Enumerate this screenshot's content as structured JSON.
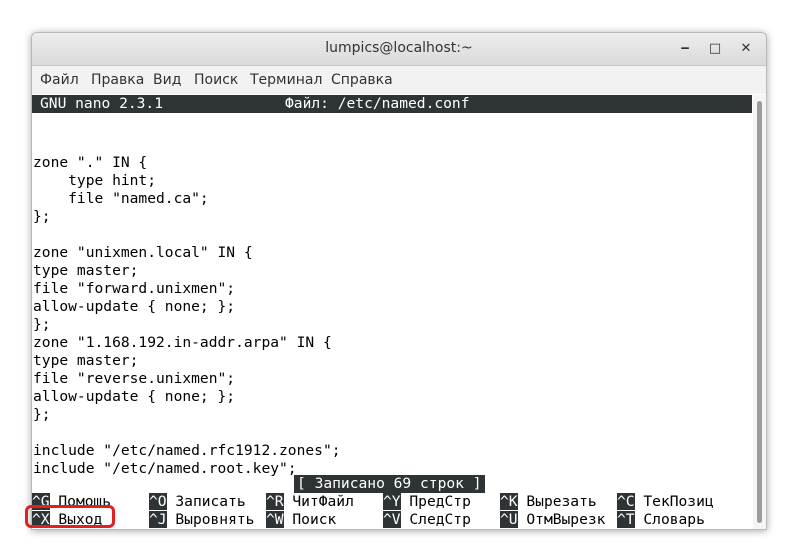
{
  "window": {
    "title": "lumpics@localhost:~",
    "minimize_glyph": "‒",
    "maximize_glyph": "□",
    "close_glyph": "✕"
  },
  "menubar": {
    "items": [
      "Файл",
      "Правка",
      "Вид",
      "Поиск",
      "Терминал",
      "Справка"
    ]
  },
  "nano": {
    "version": "GNU nano 2.3.1",
    "file_label": "Файл: /etc/named.conf",
    "lines": [
      "",
      "",
      "zone \".\" IN {",
      "    type hint;",
      "    file \"named.ca\";",
      "};",
      "",
      "zone \"unixmen.local\" IN {",
      "type master;",
      "file \"forward.unixmen\";",
      "allow-update { none; };",
      "};",
      "zone \"1.168.192.in-addr.arpa\" IN {",
      "type master;",
      "file \"reverse.unixmen\";",
      "allow-update { none; };",
      "};",
      "",
      "include \"/etc/named.rfc1912.zones\";",
      "include \"/etc/named.root.key\";"
    ],
    "status_message": "[ Записано 69 строк ]",
    "shortcuts_row1": [
      {
        "key": "^G",
        "label": "Помощь"
      },
      {
        "key": "^O",
        "label": "Записать"
      },
      {
        "key": "^R",
        "label": "ЧитФайл"
      },
      {
        "key": "^Y",
        "label": "ПредСтр"
      },
      {
        "key": "^K",
        "label": "Вырезать"
      },
      {
        "key": "^C",
        "label": "ТекПозиц"
      }
    ],
    "shortcuts_row2": [
      {
        "key": "^X",
        "label": "Выход"
      },
      {
        "key": "^J",
        "label": "Выровнять"
      },
      {
        "key": "^W",
        "label": "Поиск"
      },
      {
        "key": "^V",
        "label": "СледСтр"
      },
      {
        "key": "^U",
        "label": "ОтмВырезк"
      },
      {
        "key": "^T",
        "label": "Словарь"
      }
    ]
  },
  "colors": {
    "terminal_bg": "#ffffff",
    "terminal_fg": "#000000",
    "inverse_bg": "#2e3436",
    "highlight": "#e0211f"
  }
}
